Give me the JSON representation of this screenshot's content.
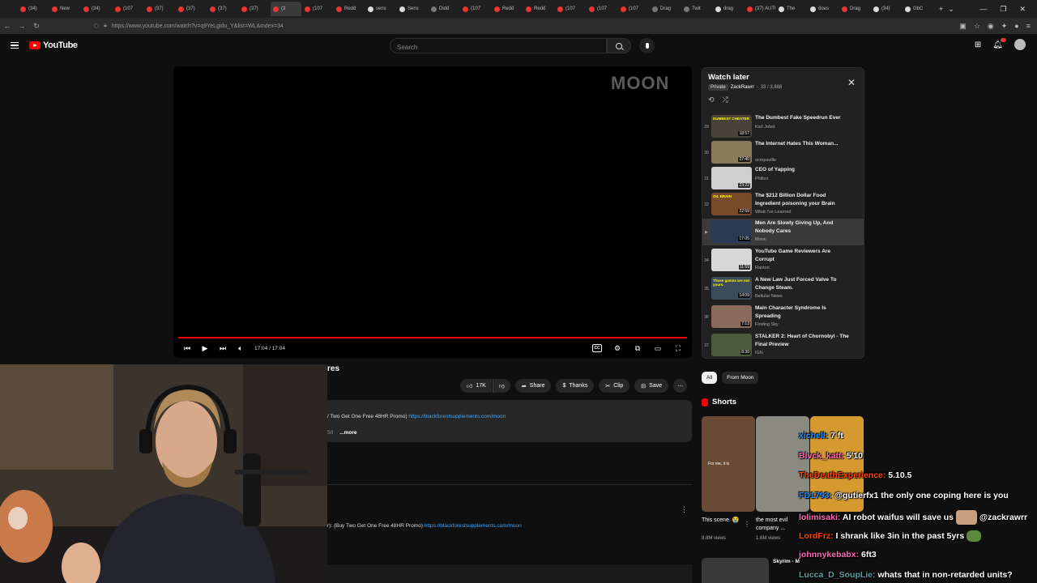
{
  "browser": {
    "tabs": [
      {
        "label": "(34)",
        "fav": "r"
      },
      {
        "label": "New",
        "fav": "r"
      },
      {
        "label": "(34)",
        "fav": "r"
      },
      {
        "label": "(107",
        "fav": "r"
      },
      {
        "label": "(37)",
        "fav": "r"
      },
      {
        "label": "(37)",
        "fav": "r"
      },
      {
        "label": "(37)",
        "fav": "r"
      },
      {
        "label": "(37)",
        "fav": "r"
      },
      {
        "label": "(3",
        "fav": "r"
      },
      {
        "label": "(107",
        "fav": "r"
      },
      {
        "label": "Redd",
        "fav": "r"
      },
      {
        "label": "sens",
        "fav": "w"
      },
      {
        "label": "Sens",
        "fav": "w"
      },
      {
        "label": "Didd",
        "fav": "g"
      },
      {
        "label": "(107",
        "fav": "r"
      },
      {
        "label": "Redd",
        "fav": "r"
      },
      {
        "label": "Redd",
        "fav": "r"
      },
      {
        "label": "(107",
        "fav": "r"
      },
      {
        "label": "(107",
        "fav": "r"
      },
      {
        "label": "(107",
        "fav": "r"
      },
      {
        "label": "Drag",
        "fav": "g"
      },
      {
        "label": "Twit",
        "fav": "g"
      },
      {
        "label": "drag",
        "fav": "w"
      },
      {
        "label": "(37) AUTO",
        "fav": "r"
      },
      {
        "label": "The",
        "fav": "w"
      },
      {
        "label": "does",
        "fav": "w"
      },
      {
        "label": "Drag",
        "fav": "r"
      },
      {
        "label": "(34)",
        "fav": "w"
      },
      {
        "label": "GbC",
        "fav": "w"
      }
    ],
    "active_tab_index": 8,
    "new_tab": "+",
    "tab_menu": "⌄",
    "url": "https://www.youtube.com/watch?v=q9YeLgidu_Y&list=WL&index=34"
  },
  "header": {
    "logo_text": "YouTube",
    "search_placeholder": "Search"
  },
  "player": {
    "watermark": "MOON",
    "time": "17:04 / 17:04",
    "progress": 1.0
  },
  "playlist": {
    "title": "Watch later",
    "privacy": "Private",
    "owner": "ZackRawrr",
    "position": "33 / 3,888",
    "items": [
      {
        "index": "29",
        "title": "The Dumbest Fake Speedrun Ever",
        "channel": "Karl Jobst",
        "duration": "18:57",
        "thumb": "#4a4238",
        "caption": "DUMBEST CHEATER",
        "active": false
      },
      {
        "index": "30",
        "title": "The Internet Hates This Woman...",
        "channel": "ocmpaville",
        "duration": "27:40",
        "thumb": "#8a7a5a",
        "caption": "",
        "active": false
      },
      {
        "index": "31",
        "title": "CEO of Yapping",
        "channel": "Philion",
        "duration": "23:22",
        "thumb": "#cfcfcf",
        "caption": "",
        "active": false
      },
      {
        "index": "32",
        "title": "The $212 Billion Dollar Food Ingredient poisoning your Brain",
        "channel": "What I've Learned",
        "duration": "22:59",
        "thumb": "#7a4a2a",
        "caption": "OIL BRAIN",
        "active": false
      },
      {
        "index": "▶",
        "title": "Men Are Slowly Giving Up, And Nobody Cares",
        "channel": "Moon",
        "duration": "17:05",
        "thumb": "#2a3a55",
        "caption": "",
        "active": true
      },
      {
        "index": "34",
        "title": "YouTube Game Reviewers Are Corrupt",
        "channel": "Ranton",
        "duration": "11:59",
        "thumb": "#d8d8d8",
        "caption": "",
        "active": false
      },
      {
        "index": "35",
        "title": "A New Law Just Forced Valve To Change Steam.",
        "channel": "Bellular News",
        "duration": "14:09",
        "thumb": "#3d4a5a",
        "caption": "Those games are not yours.",
        "active": false
      },
      {
        "index": "36",
        "title": "Main Character Syndrome Is Spreading",
        "channel": "Finding Sky",
        "duration": "7:13",
        "thumb": "#8a6a5a",
        "caption": "",
        "active": false
      },
      {
        "index": "37",
        "title": "STALKER 2: Heart of Chornobyl - The Final Preview",
        "channel": "IGN",
        "duration": "8:30",
        "thumb": "#4a5a3a",
        "caption": "",
        "active": false
      }
    ]
  },
  "video": {
    "title_fragment": "res",
    "likes": "17K",
    "share": "Share",
    "thanks": "Thanks",
    "clip": "Clip",
    "save": "Save",
    "desc_line1_text": "/ Two Get One Free 48HR Promo)",
    "desc_line1_link": "https://blackforestsupplements.com/moon",
    "desc_more_faint": "50",
    "desc_more": "...more",
    "pinned_text": "r): (Buy Two Get One Free 48HR Promo)",
    "pinned_link": "https://blackforestsupplements.com/moon"
  },
  "sidebar": {
    "chips": [
      "All",
      "From Moon"
    ],
    "shorts_label": "Shorts",
    "shorts": [
      {
        "title": "This scene. 😭",
        "views": "8.8M views",
        "thumb": "#6a4a35",
        "caption": "For me, it is"
      },
      {
        "title": "the most evil company ...",
        "views": "1.6M views",
        "thumb": "#8a8a80",
        "caption": ""
      },
      {
        "title": "",
        "views": "",
        "thumb": "#d49a30",
        "caption": ""
      }
    ],
    "next_title": "Skyrim - M"
  },
  "chat": [
    {
      "user": "xichell:",
      "msg": "7 ft",
      "color": "#1e90ff"
    },
    {
      "user": "Blvck_katt:",
      "msg": "5'10",
      "color": "#ff69b4"
    },
    {
      "user": "TheDeathExperience:",
      "msg": "5.10.5",
      "color": "#ff4500"
    },
    {
      "user": "FD1793:",
      "msg": "@gutierfx1 the only one coping here is you",
      "color": "#1e90ff"
    },
    {
      "user": "lolimisaki:",
      "msg": "AI robot waifus will save us",
      "msg2": "@zackrawrr",
      "color": "#ff69b4"
    },
    {
      "user": "LordFrz:",
      "msg": "I shrank like 3in in the past 5yrs",
      "color": "#ff4500"
    },
    {
      "user": "johnnykebabx:",
      "msg": "6ft3",
      "color": "#ff69b4"
    },
    {
      "user": "Lucca_D_SoupLie:",
      "msg": "whats that in non-retarded units?",
      "color": "#5f9ea0"
    }
  ]
}
